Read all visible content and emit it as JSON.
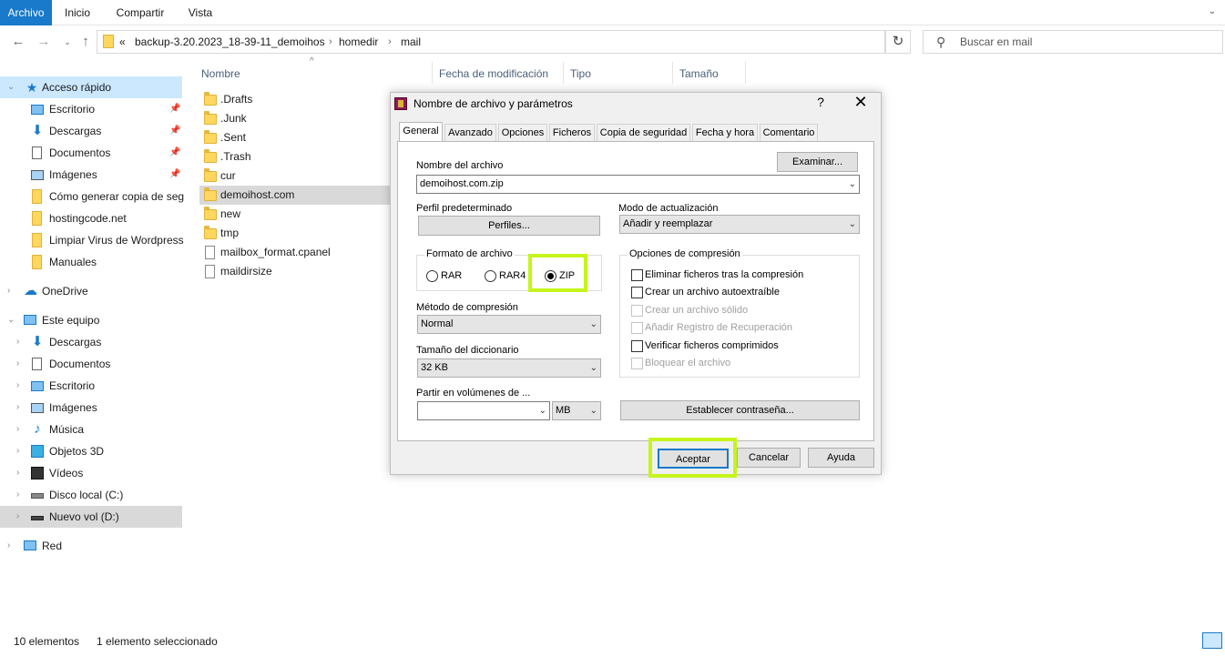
{
  "ribbon": {
    "tabs": [
      "Archivo",
      "Inicio",
      "Compartir",
      "Vista"
    ]
  },
  "address": {
    "overflow": "«",
    "crumbs": [
      "backup-3.20.2023_18-39-11_demoihos",
      "homedir",
      "mail"
    ],
    "search_placeholder": "Buscar en mail"
  },
  "nav": {
    "quick_access": "Acceso rápido",
    "quick_items": [
      "Escritorio",
      "Descargas",
      "Documentos",
      "Imágenes",
      "Cómo generar copia de seg",
      "hostingcode.net",
      "Limpiar Virus de Wordpress",
      "Manuales"
    ],
    "onedrive": "OneDrive",
    "this_pc": "Este equipo",
    "pc_items": [
      "Descargas",
      "Documentos",
      "Escritorio",
      "Imágenes",
      "Música",
      "Objetos 3D",
      "Vídeos",
      "Disco local (C:)",
      "Nuevo vol (D:)"
    ],
    "network": "Red"
  },
  "filelist": {
    "columns": [
      "Nombre",
      "Fecha de modificación",
      "Tipo",
      "Tamaño"
    ],
    "items": [
      ".Drafts",
      ".Junk",
      ".Sent",
      ".Trash",
      "cur",
      "demoihost.com",
      "new",
      "tmp",
      "mailbox_format.cpanel",
      "maildirsize"
    ],
    "selected_index": 5
  },
  "status": {
    "count": "10 elementos",
    "selection": "1 elemento seleccionado"
  },
  "dialog": {
    "title": "Nombre de archivo y parámetros",
    "help": "?",
    "close": "✕",
    "tabs": [
      "General",
      "Avanzado",
      "Opciones",
      "Ficheros",
      "Copia de seguridad",
      "Fecha y hora",
      "Comentario"
    ],
    "active_tab": "General",
    "filename_label": "Nombre del archivo",
    "browse_button": "Examinar...",
    "filename_value": "demoihost.com.zip",
    "profile_label": "Perfil predeterminado",
    "profiles_button": "Perfiles...",
    "update_mode_label": "Modo de actualización",
    "update_mode_value": "Añadir y reemplazar",
    "format_group": "Formato de archivo",
    "formats": [
      "RAR",
      "RAR4",
      "ZIP"
    ],
    "selected_format": "ZIP",
    "method_label": "Método de compresión",
    "method_value": "Normal",
    "dict_label": "Tamaño del diccionario",
    "dict_value": "32 KB",
    "split_label": "Partir en volúmenes de ...",
    "split_value": "",
    "split_unit": "MB",
    "options_group": "Opciones de compresión",
    "options": [
      {
        "label": "Eliminar ficheros tras la compresión",
        "enabled": true
      },
      {
        "label": "Crear un archivo autoextraíble",
        "enabled": true
      },
      {
        "label": "Crear un archivo sólido",
        "enabled": false
      },
      {
        "label": "Añadir Registro de Recuperación",
        "enabled": false
      },
      {
        "label": "Verificar ficheros comprimidos",
        "enabled": true
      },
      {
        "label": "Bloquear el archivo",
        "enabled": false
      }
    ],
    "password_button": "Establecer contraseña...",
    "ok_button": "Aceptar",
    "cancel_button": "Cancelar",
    "help_button": "Ayuda"
  },
  "colors": {
    "accent": "#1979ca",
    "highlight": "#c6f51b",
    "folder": "#ffd75e"
  }
}
